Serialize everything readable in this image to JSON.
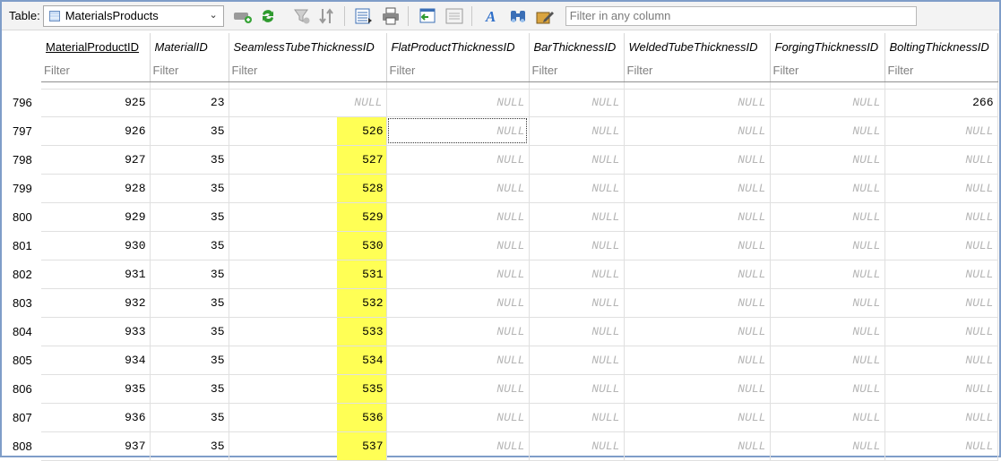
{
  "toolbar": {
    "table_label": "Table:",
    "table_name": "MaterialsProducts",
    "filter_placeholder": "Filter in any column"
  },
  "colors": {
    "highlight": "#ffff55",
    "null_text": "#b5b5b5",
    "frame": "#7f9dc8"
  },
  "columns": [
    "MaterialProductID",
    "MaterialID",
    "SeamlessTubeThicknessID",
    "FlatProductThicknessID",
    "BarThicknessID",
    "WeldedTubeThicknessID",
    "ForgingThicknessID",
    "BoltingThicknessID"
  ],
  "filter_placeholder": "Filter",
  "rows": [
    {
      "n": "796",
      "c": [
        "925",
        "23",
        "NULL",
        "NULL",
        "NULL",
        "NULL",
        "NULL",
        "266"
      ]
    },
    {
      "n": "797",
      "c": [
        "926",
        "35",
        "526",
        "NULL",
        "NULL",
        "NULL",
        "NULL",
        "NULL"
      ]
    },
    {
      "n": "798",
      "c": [
        "927",
        "35",
        "527",
        "NULL",
        "NULL",
        "NULL",
        "NULL",
        "NULL"
      ]
    },
    {
      "n": "799",
      "c": [
        "928",
        "35",
        "528",
        "NULL",
        "NULL",
        "NULL",
        "NULL",
        "NULL"
      ]
    },
    {
      "n": "800",
      "c": [
        "929",
        "35",
        "529",
        "NULL",
        "NULL",
        "NULL",
        "NULL",
        "NULL"
      ]
    },
    {
      "n": "801",
      "c": [
        "930",
        "35",
        "530",
        "NULL",
        "NULL",
        "NULL",
        "NULL",
        "NULL"
      ]
    },
    {
      "n": "802",
      "c": [
        "931",
        "35",
        "531",
        "NULL",
        "NULL",
        "NULL",
        "NULL",
        "NULL"
      ]
    },
    {
      "n": "803",
      "c": [
        "932",
        "35",
        "532",
        "NULL",
        "NULL",
        "NULL",
        "NULL",
        "NULL"
      ]
    },
    {
      "n": "804",
      "c": [
        "933",
        "35",
        "533",
        "NULL",
        "NULL",
        "NULL",
        "NULL",
        "NULL"
      ]
    },
    {
      "n": "805",
      "c": [
        "934",
        "35",
        "534",
        "NULL",
        "NULL",
        "NULL",
        "NULL",
        "NULL"
      ]
    },
    {
      "n": "806",
      "c": [
        "935",
        "35",
        "535",
        "NULL",
        "NULL",
        "NULL",
        "NULL",
        "NULL"
      ]
    },
    {
      "n": "807",
      "c": [
        "936",
        "35",
        "536",
        "NULL",
        "NULL",
        "NULL",
        "NULL",
        "NULL"
      ]
    },
    {
      "n": "808",
      "c": [
        "937",
        "35",
        "537",
        "NULL",
        "NULL",
        "NULL",
        "NULL",
        "NULL"
      ]
    }
  ]
}
